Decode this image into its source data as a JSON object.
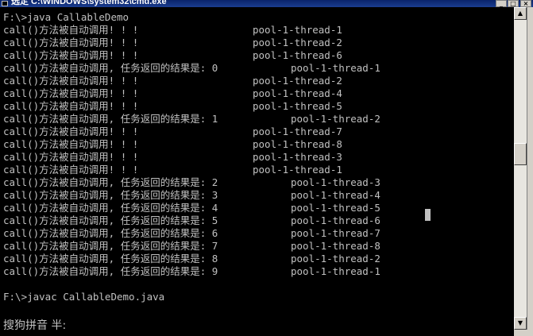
{
  "window": {
    "title": "选定 C:\\WINDOWS\\system32\\cmd.exe",
    "minimize_glyph": "_",
    "maximize_glyph": "□",
    "close_glyph": "×"
  },
  "console": {
    "lines": [
      {
        "left": "F:\\>java CallableDemo",
        "mid": "",
        "right": ""
      },
      {
        "left": "call()方法被自动调用! ! !",
        "mid": "",
        "right": "pool-1-thread-1"
      },
      {
        "left": "call()方法被自动调用! ! !",
        "mid": "",
        "right": "pool-1-thread-2"
      },
      {
        "left": "call()方法被自动调用! ! !",
        "mid": "",
        "right": "pool-1-thread-6"
      },
      {
        "left": "call()方法被自动调用, 任务返回的结果是: 0",
        "mid": "",
        "right": "pool-1-thread-1"
      },
      {
        "left": "call()方法被自动调用! ! !",
        "mid": "",
        "right": "pool-1-thread-2"
      },
      {
        "left": "call()方法被自动调用! ! !",
        "mid": "",
        "right": "pool-1-thread-4"
      },
      {
        "left": "call()方法被自动调用! ! !",
        "mid": "",
        "right": "pool-1-thread-5"
      },
      {
        "left": "call()方法被自动调用, 任务返回的结果是: 1",
        "mid": "",
        "right": "pool-1-thread-2"
      },
      {
        "left": "call()方法被自动调用! ! !",
        "mid": "",
        "right": "pool-1-thread-7"
      },
      {
        "left": "call()方法被自动调用! ! !",
        "mid": "",
        "right": "pool-1-thread-8"
      },
      {
        "left": "call()方法被自动调用! ! !",
        "mid": "",
        "right": "pool-1-thread-3"
      },
      {
        "left": "call()方法被自动调用! ! !",
        "mid": "",
        "right": "pool-1-thread-1"
      },
      {
        "left": "call()方法被自动调用, 任务返回的结果是: 2",
        "mid": "",
        "right": "pool-1-thread-3"
      },
      {
        "left": "call()方法被自动调用, 任务返回的结果是: 3",
        "mid": "",
        "right": "pool-1-thread-4"
      },
      {
        "left": "call()方法被自动调用, 任务返回的结果是: 4",
        "mid": "",
        "right": "pool-1-thread-5"
      },
      {
        "left": "call()方法被自动调用, 任务返回的结果是: 5",
        "mid": "",
        "right": "pool-1-thread-6"
      },
      {
        "left": "call()方法被自动调用, 任务返回的结果是: 6",
        "mid": "",
        "right": "pool-1-thread-7"
      },
      {
        "left": "call()方法被自动调用, 任务返回的结果是: 7",
        "mid": "",
        "right": "pool-1-thread-8"
      },
      {
        "left": "call()方法被自动调用, 任务返回的结果是: 8",
        "mid": "",
        "right": "pool-1-thread-2"
      },
      {
        "left": "call()方法被自动调用, 任务返回的结果是: 9",
        "mid": "",
        "right": "pool-1-thread-1"
      },
      {
        "left": "",
        "mid": "",
        "right": ""
      },
      {
        "left": "F:\\>javac CallableDemo.java",
        "mid": "",
        "right": ""
      }
    ]
  },
  "ime": {
    "status": "搜狗拼音 半:"
  },
  "scrollbar": {
    "up_glyph": "▲",
    "down_glyph": "▼"
  }
}
